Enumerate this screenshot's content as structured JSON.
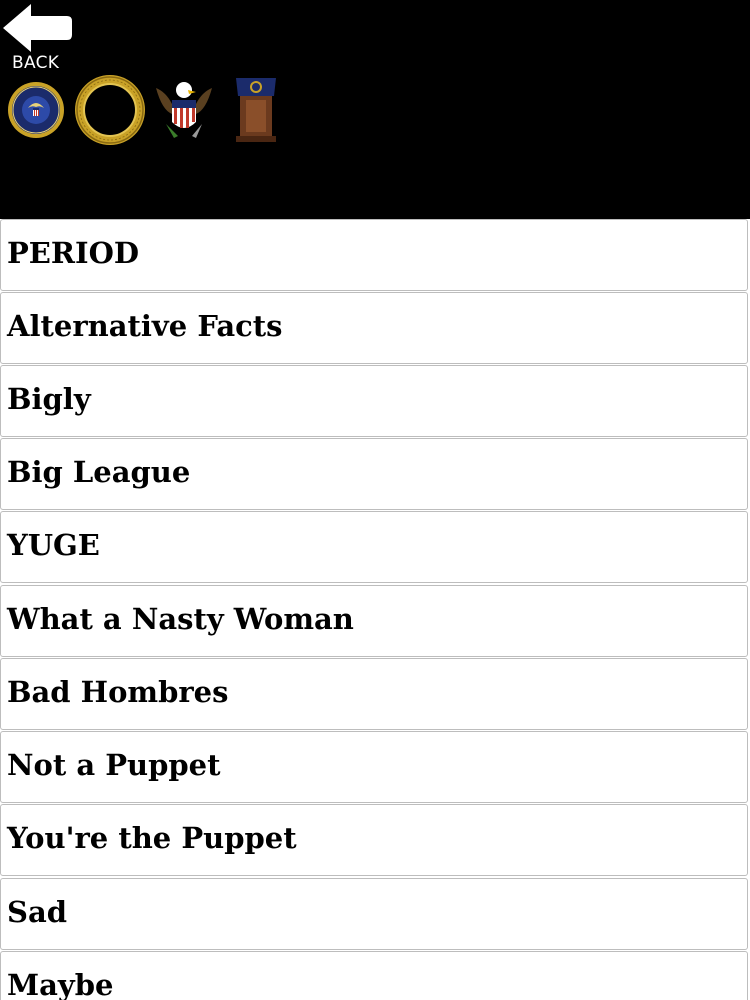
{
  "header": {
    "back_label": "BACK",
    "icons": [
      {
        "name": "presidential-seal-icon"
      },
      {
        "name": "gold-ring-seal-icon"
      },
      {
        "name": "eagle-shield-icon"
      },
      {
        "name": "podium-icon"
      }
    ]
  },
  "colors": {
    "header_bg": "#000000",
    "list_bg": "#ffffff",
    "row_border": "#bdbdbd",
    "text": "#000000",
    "seal_blue": "#1b2b6b",
    "seal_gold": "#c9a227",
    "podium_brown": "#6b3a1e"
  },
  "phrases": [
    {
      "label": "PERIOD"
    },
    {
      "label": "Alternative Facts"
    },
    {
      "label": "Bigly"
    },
    {
      "label": "Big League"
    },
    {
      "label": "YUGE"
    },
    {
      "label": "What a Nasty Woman"
    },
    {
      "label": "Bad Hombres"
    },
    {
      "label": "Not a Puppet"
    },
    {
      "label": "You're the Puppet"
    },
    {
      "label": "Sad"
    },
    {
      "label": "Maybe"
    }
  ]
}
